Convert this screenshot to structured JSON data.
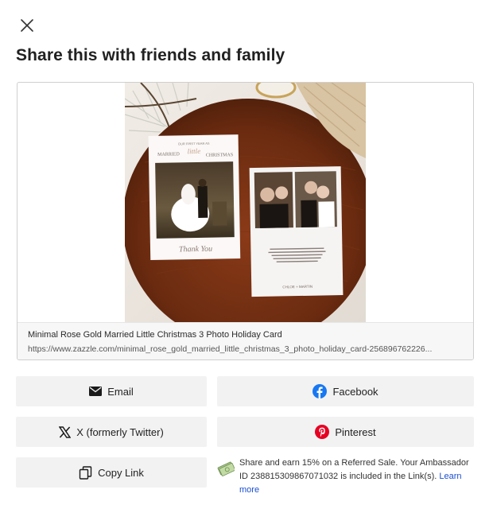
{
  "dialog": {
    "title": "Share this with friends and family",
    "close_icon": "close-icon"
  },
  "preview": {
    "product_name": "Minimal Rose Gold Married Little Christmas 3 Photo Holiday Card",
    "product_url": "https://www.zazzle.com/minimal_rose_gold_married_little_christmas_3_photo_holiday_card-256896762226...",
    "card_front": {
      "line_top": "OUR FIRST YEAR AS",
      "line_mid": "MARRIED",
      "script": "little",
      "line_end": "CHRISTMAS",
      "thanks": "Thank You"
    },
    "card_back": {
      "names": "CHLOE + MARTIN"
    }
  },
  "share_buttons": {
    "email": {
      "label": "Email",
      "icon": "envelope-icon"
    },
    "facebook": {
      "label": "Facebook",
      "icon": "facebook-icon",
      "color": "#1877f2"
    },
    "x": {
      "label": "X (formerly Twitter)",
      "icon": "x-icon"
    },
    "pinterest": {
      "label": "Pinterest",
      "icon": "pinterest-icon",
      "color": "#e60023"
    },
    "copy": {
      "label": "Copy Link",
      "icon": "copy-icon"
    }
  },
  "ambassador": {
    "text": "Share and earn 15% on a Referred Sale. Your Ambassador ID 238815309867071032 is included in the Link(s).",
    "learn_more": "Learn more",
    "link_color": "#1b4fd1",
    "icon": "money-icon"
  }
}
